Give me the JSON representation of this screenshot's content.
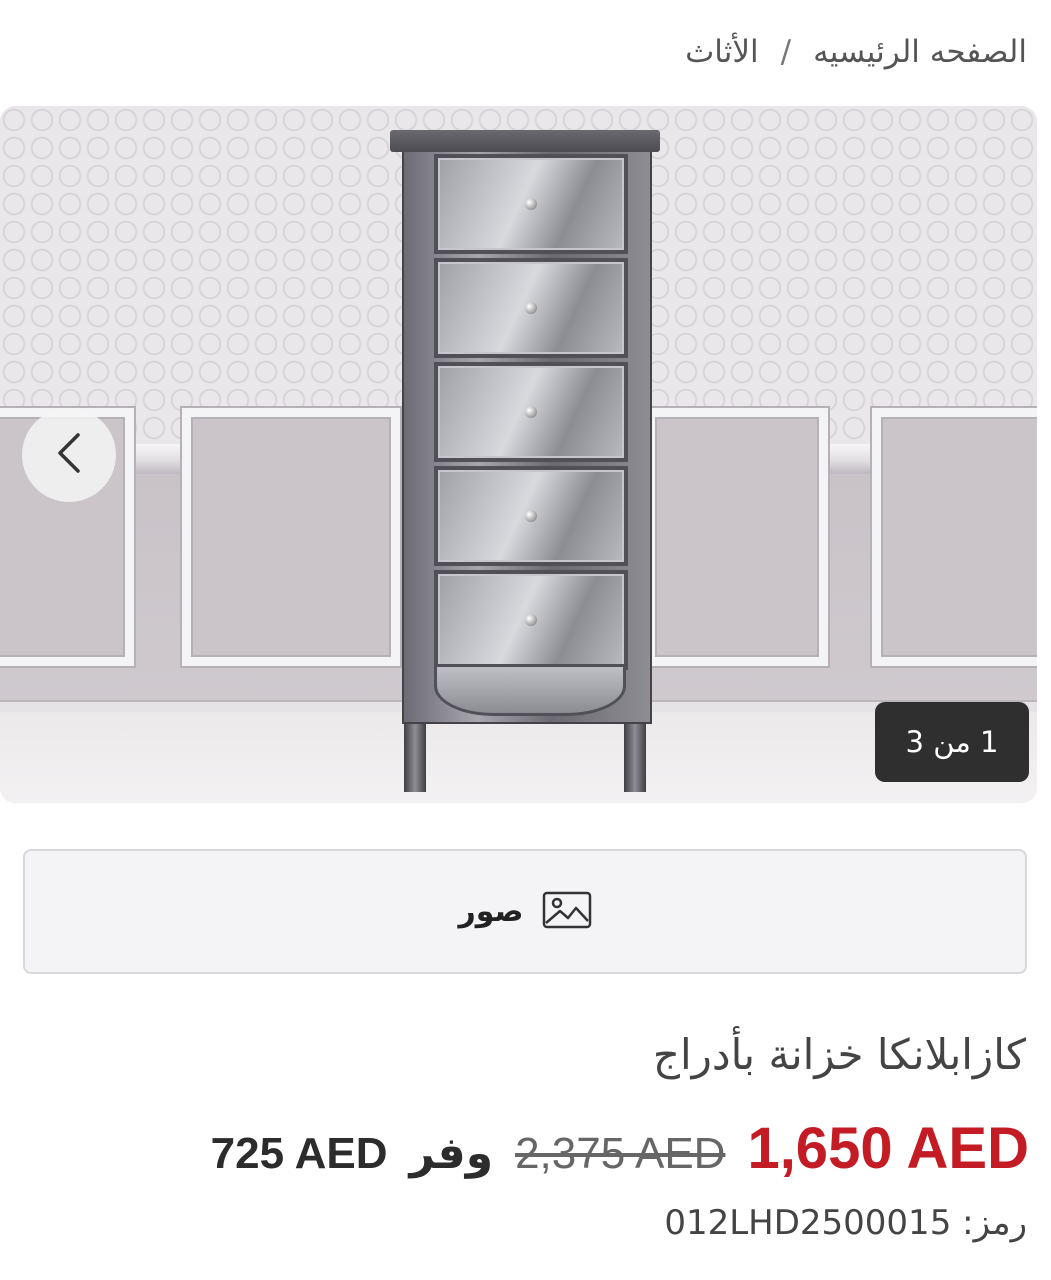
{
  "breadcrumb": {
    "home": "الصفحه الرئيسيه",
    "separator": "/",
    "category": "الأثاث"
  },
  "gallery": {
    "counter": "1 من 3",
    "prev_icon": "chevron-left-icon"
  },
  "photos_button": {
    "label": "صور",
    "icon": "image-icon"
  },
  "product": {
    "title": "كازابلانكا خزانة بأدراج",
    "price": "1,650 AED",
    "old_price": "2,375 AED",
    "save_label": "وفر",
    "save_amount": "725 AED",
    "sku_label": "رمز:",
    "sku_value": "012LHD2500015"
  },
  "colors": {
    "price": "#c31c24",
    "badge_bg": "#2f2f30"
  }
}
